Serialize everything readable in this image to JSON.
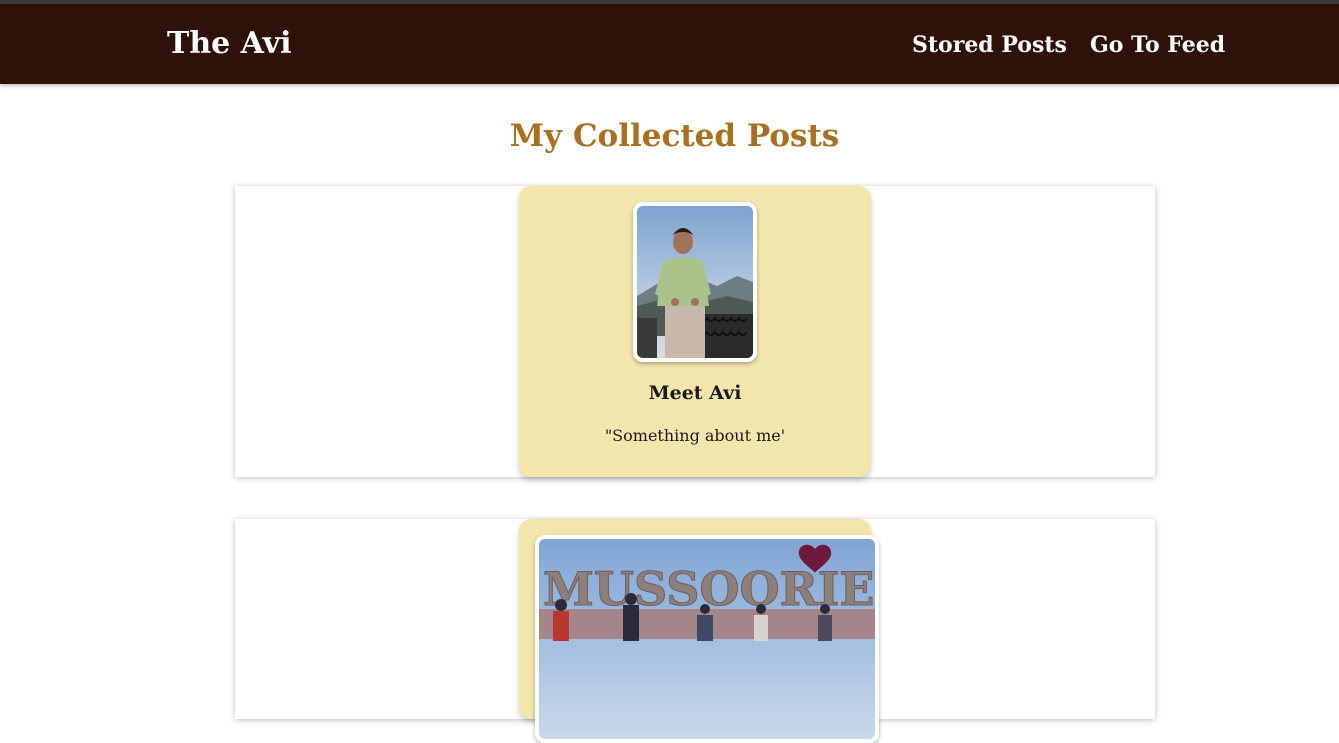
{
  "navbar": {
    "brand": "The Avi",
    "links": [
      "Stored Posts",
      "Go To Feed"
    ]
  },
  "page_title": "My Collected Posts",
  "posts": [
    {
      "title": "Meet Avi",
      "excerpt": "\"Something about me'",
      "image": "person-on-balcony-photo"
    },
    {
      "image": "mussoorie-queen-of-hills-photo",
      "image_text": "MUSSOORIE"
    }
  ],
  "colors": {
    "navbar": "#2f110a",
    "title": "#a8701f",
    "card": "#f3e6ad"
  }
}
